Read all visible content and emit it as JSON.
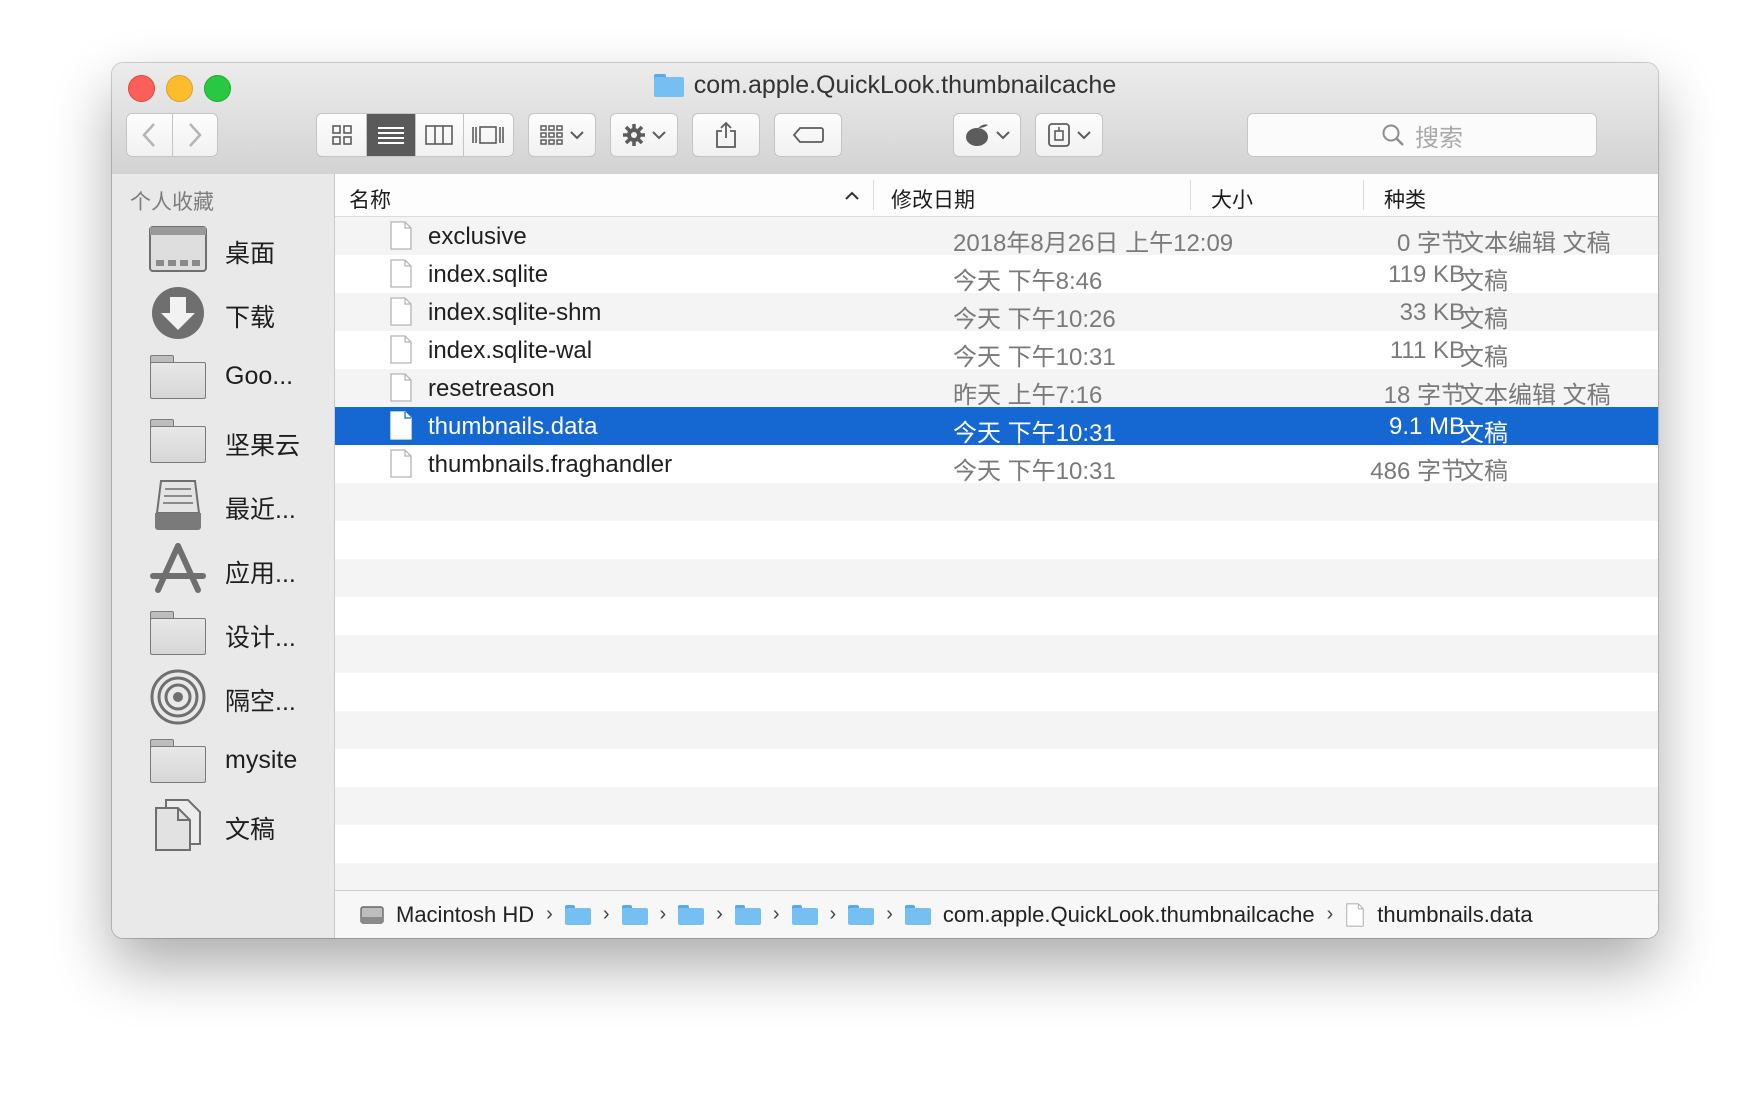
{
  "window": {
    "title": "com.apple.QuickLook.thumbnailcache"
  },
  "toolbar": {
    "search_placeholder": "搜索",
    "colors": {
      "folder_blue": "#76bff3",
      "selection": "#1567d2"
    }
  },
  "sidebar": {
    "header": "个人收藏",
    "items": [
      {
        "label": "桌面",
        "icon": "desktop-icon"
      },
      {
        "label": "下载",
        "icon": "downloads-icon"
      },
      {
        "label": "Goo...",
        "icon": "folder-icon"
      },
      {
        "label": "坚果云",
        "icon": "folder-icon"
      },
      {
        "label": "最近...",
        "icon": "recents-icon"
      },
      {
        "label": "应用...",
        "icon": "applications-icon"
      },
      {
        "label": "设计...",
        "icon": "folder-icon"
      },
      {
        "label": "隔空...",
        "icon": "airdrop-icon"
      },
      {
        "label": "mysite",
        "icon": "folder-icon"
      },
      {
        "label": "文稿",
        "icon": "documents-icon"
      }
    ]
  },
  "columns": {
    "name": "名称",
    "date": "修改日期",
    "size": "大小",
    "kind": "种类"
  },
  "files": [
    {
      "name": "exclusive",
      "date": "2018年8月26日 上午12:09",
      "size": "0 字节",
      "kind": "文本编辑 文稿"
    },
    {
      "name": "index.sqlite",
      "date": "今天 下午8:46",
      "size": "119 KB",
      "kind": "文稿"
    },
    {
      "name": "index.sqlite-shm",
      "date": "今天 下午10:26",
      "size": "33 KB",
      "kind": "文稿"
    },
    {
      "name": "index.sqlite-wal",
      "date": "今天 下午10:31",
      "size": "111 KB",
      "kind": "文稿"
    },
    {
      "name": "resetreason",
      "date": "昨天 上午7:16",
      "size": "18 字节",
      "kind": "文本编辑 文稿"
    },
    {
      "name": "thumbnails.data",
      "date": "今天 下午10:31",
      "size": "9.1 MB",
      "kind": "文稿",
      "selected": true
    },
    {
      "name": "thumbnails.fraghandler",
      "date": "今天 下午10:31",
      "size": "486 字节",
      "kind": "文稿"
    }
  ],
  "pathbar": {
    "root": "Macintosh HD",
    "current_folder": "com.apple.QuickLook.thumbnailcache",
    "file": "thumbnails.data"
  }
}
